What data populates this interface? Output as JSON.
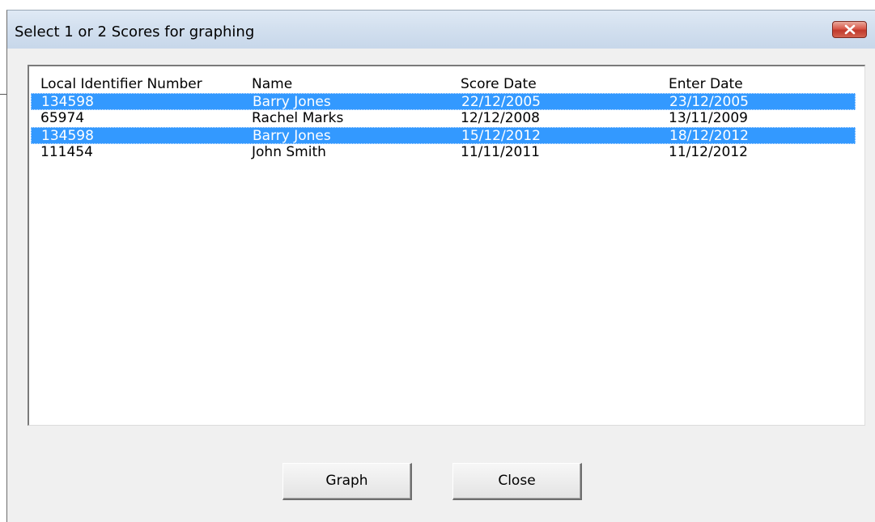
{
  "dialog": {
    "title": "Select 1 or 2 Scores for graphing",
    "close_icon": "close-x-icon"
  },
  "list": {
    "columns": [
      "Local Identifier Number",
      "Name",
      "Score Date",
      "Enter Date"
    ],
    "rows": [
      {
        "id": "134598",
        "name": "Barry Jones",
        "score_date": "22/12/2005",
        "enter_date": "23/12/2005",
        "selected": true
      },
      {
        "id": "65974",
        "name": "Rachel Marks",
        "score_date": "12/12/2008",
        "enter_date": "13/11/2009",
        "selected": false
      },
      {
        "id": "134598",
        "name": "Barry Jones",
        "score_date": "15/12/2012",
        "enter_date": "18/12/2012",
        "selected": true
      },
      {
        "id": "111454",
        "name": "John Smith",
        "score_date": "11/11/2011",
        "enter_date": "11/12/2012",
        "selected": false
      }
    ]
  },
  "buttons": {
    "graph_label": "Graph",
    "close_label": "Close"
  },
  "colors": {
    "selection": "#3399ff",
    "titlebar": "#d3e0ef",
    "close_button": "#c0392b"
  }
}
